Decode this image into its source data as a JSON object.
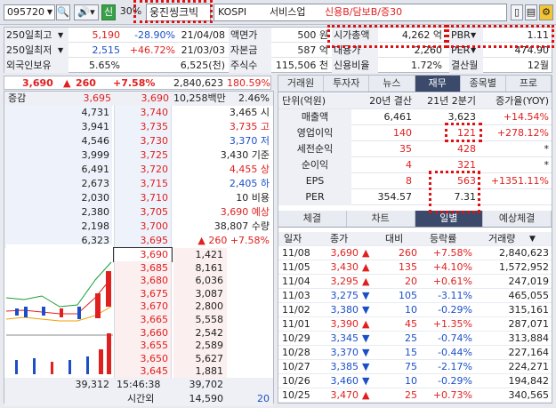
{
  "toolbar": {
    "code": "095720",
    "sin_label": "신",
    "pct_label": "30%",
    "stock_name": "웅진씽크빅",
    "market": "KOSPI",
    "sector": "서비스업",
    "credit_info": "신용B/담보B/증30"
  },
  "summary": {
    "rows": [
      {
        "label": "250일최고",
        "value": "5,190",
        "change": "-28.90%",
        "date": "21/04/08",
        "l2": "액면가",
        "v2": "500 원",
        "l3": "시가총액",
        "v3": "4,262 억",
        "l4": "PBR",
        "v4": "1.11"
      },
      {
        "label": "250일최저",
        "value": "2,515",
        "change": "+46.72%",
        "date": "21/03/03",
        "l2": "자본금",
        "v2": "587 억",
        "l3": "대용가",
        "v3": "2,260",
        "l4": "PER",
        "v4": "474.90"
      },
      {
        "label": "외국인보유",
        "value": "5.65%",
        "change": "",
        "date": "6,525(천)",
        "l2": "주식수",
        "v2": "115,506 천",
        "l3": "신용비율",
        "v3": "1.72%",
        "l4": "결산월",
        "v4": "12월"
      }
    ]
  },
  "pricebar": {
    "price": "3,690",
    "change": "260",
    "pct": "+7.58%",
    "volume": "2,840,623",
    "ratio": "180.59%"
  },
  "orderbook": {
    "header_left": "증감",
    "header_price1": "3,695",
    "header_price2": "3,690",
    "header_amount": "10,258백만",
    "header_pct": "2.46%",
    "sell": [
      {
        "qty": "4,731",
        "price": "3,740",
        "info": "3,465 시"
      },
      {
        "qty": "3,941",
        "price": "3,735",
        "info": "3,735 고"
      },
      {
        "qty": "4,546",
        "price": "3,730",
        "info": "3,370 저"
      },
      {
        "qty": "3,999",
        "price": "3,725",
        "info": "3,430 기준"
      },
      {
        "qty": "6,491",
        "price": "3,720",
        "info": "4,455 상"
      },
      {
        "qty": "2,673",
        "price": "3,715",
        "info": "2,405 하"
      },
      {
        "qty": "2,030",
        "price": "3,710",
        "info": "10 비용"
      },
      {
        "qty": "2,380",
        "price": "3,705",
        "info": "3,690 예상"
      },
      {
        "qty": "2,198",
        "price": "3,700",
        "info": "38,807 수량"
      },
      {
        "qty": "6,323",
        "price": "3,695",
        "info": "▲ 260   +7.58%"
      }
    ],
    "buy": [
      {
        "price": "3,690",
        "qty": "1,421"
      },
      {
        "price": "3,685",
        "qty": "8,161"
      },
      {
        "price": "3,680",
        "qty": "6,036"
      },
      {
        "price": "3,675",
        "qty": "3,087"
      },
      {
        "price": "3,670",
        "qty": "2,800"
      },
      {
        "price": "3,665",
        "qty": "5,558"
      },
      {
        "price": "3,660",
        "qty": "2,542"
      },
      {
        "price": "3,655",
        "qty": "2,589"
      },
      {
        "price": "3,650",
        "qty": "5,627"
      },
      {
        "price": "3,645",
        "qty": "1,881"
      }
    ],
    "footer": {
      "total_sell": "39,312",
      "time": "15:46:38",
      "total_buy": "39,702",
      "after_label": "시간외",
      "after_qty": "14,590",
      "after_n": "20"
    }
  },
  "fin": {
    "tabs": [
      "거래원",
      "투자자",
      "뉴스",
      "재무",
      "종목별",
      "프로"
    ],
    "active_tab": 3,
    "header": {
      "unit": "단위(억원)",
      "c1": "20년 결산",
      "c2": "21년 2분기",
      "c3": "증가율(YOY)"
    },
    "rows": [
      {
        "name": "매출액",
        "v1": "6,461",
        "v2": "3,623",
        "v3": "+14.54%"
      },
      {
        "name": "영업이익",
        "v1": "140",
        "v2": "121",
        "v3": "+278.12%"
      },
      {
        "name": "세전순익",
        "v1": "35",
        "v2": "428",
        "v3": "*"
      },
      {
        "name": "순이익",
        "v1": "4",
        "v2": "321",
        "v3": "*"
      },
      {
        "name": "EPS",
        "v1": "8",
        "v2": "563",
        "v3": "+1351.11%"
      },
      {
        "name": "PER",
        "v1": "354.57",
        "v2": "7.31",
        "v3": ""
      }
    ],
    "subtabs": [
      "체결",
      "차트",
      "일별",
      "예상체결"
    ],
    "active_subtab": 2,
    "daily_header": {
      "date": "일자",
      "close": "종가",
      "diff": "대비",
      "rate": "등락률",
      "volume": "거래량"
    },
    "daily": [
      {
        "date": "11/08",
        "close": "3,690",
        "dir": "up",
        "diff": "260",
        "rate": "+7.58%",
        "volume": "2,840,623"
      },
      {
        "date": "11/05",
        "close": "3,430",
        "dir": "up",
        "diff": "135",
        "rate": "+4.10%",
        "volume": "1,572,952"
      },
      {
        "date": "11/04",
        "close": "3,295",
        "dir": "up",
        "diff": "20",
        "rate": "+0.61%",
        "volume": "247,019"
      },
      {
        "date": "11/03",
        "close": "3,275",
        "dir": "down",
        "diff": "105",
        "rate": "-3.11%",
        "volume": "465,055"
      },
      {
        "date": "11/02",
        "close": "3,380",
        "dir": "down",
        "diff": "10",
        "rate": "-0.29%",
        "volume": "315,161"
      },
      {
        "date": "11/01",
        "close": "3,390",
        "dir": "up",
        "diff": "45",
        "rate": "+1.35%",
        "volume": "287,071"
      },
      {
        "date": "10/29",
        "close": "3,345",
        "dir": "down",
        "diff": "25",
        "rate": "-0.74%",
        "volume": "313,884"
      },
      {
        "date": "10/28",
        "close": "3,370",
        "dir": "down",
        "diff": "15",
        "rate": "-0.44%",
        "volume": "227,164"
      },
      {
        "date": "10/27",
        "close": "3,385",
        "dir": "down",
        "diff": "75",
        "rate": "-2.17%",
        "volume": "224,271"
      },
      {
        "date": "10/26",
        "close": "3,460",
        "dir": "down",
        "diff": "10",
        "rate": "-0.29%",
        "volume": "194,842"
      },
      {
        "date": "10/25",
        "close": "3,470",
        "dir": "up",
        "diff": "25",
        "rate": "+0.73%",
        "volume": "340,565"
      }
    ]
  },
  "colors": {
    "up": "#e0201f",
    "down": "#1a4fc8",
    "highlight": "#d11111"
  }
}
